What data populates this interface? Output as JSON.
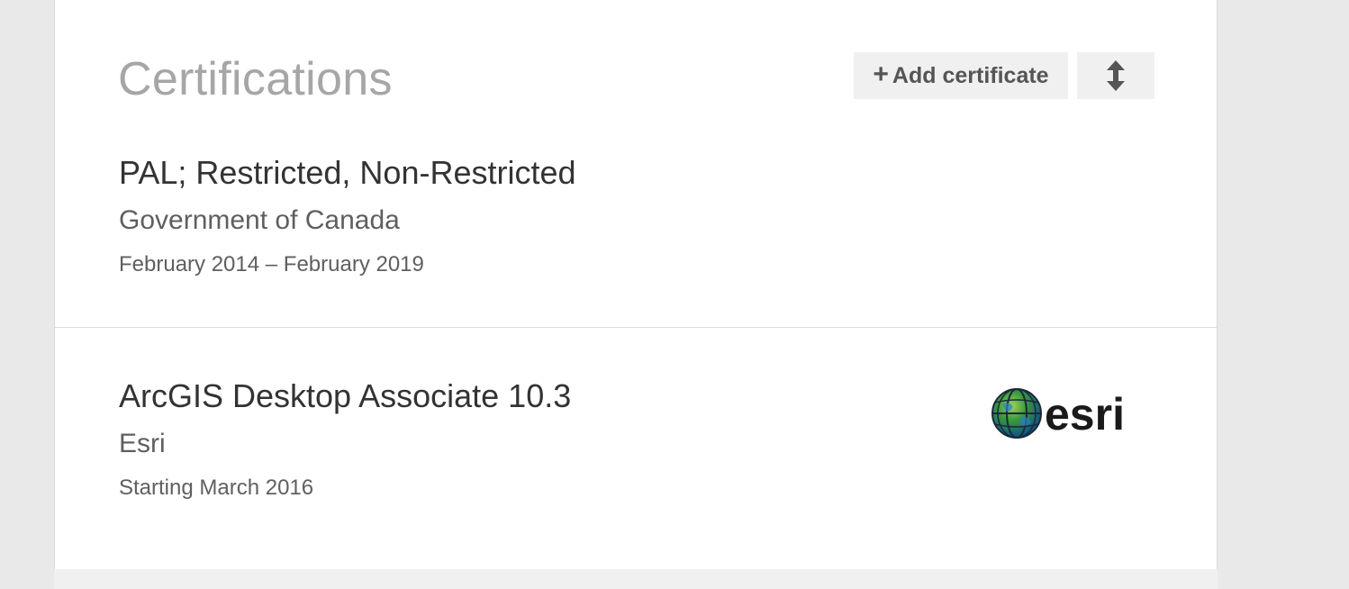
{
  "section": {
    "title": "Certifications",
    "add_button_label": "Add certificate",
    "add_button_icon": "plus-icon",
    "reorder_button_icon": "reorder-vertical-icon"
  },
  "certifications": [
    {
      "name": "PAL; Restricted, Non-Restricted",
      "issuer": "Government of Canada",
      "dates": "February 2014 – February 2019"
    },
    {
      "name": "ArcGIS Desktop Associate 10.3",
      "issuer": "Esri",
      "dates": "Starting March 2016",
      "logo_text": "esri"
    }
  ],
  "colors": {
    "page_background": "#e9e9e9",
    "card_background": "#ffffff",
    "button_background": "#f0f0f0",
    "title_gray": "#a6a6a6",
    "text_dark": "#333333",
    "text_muted": "#5f5f5f"
  }
}
